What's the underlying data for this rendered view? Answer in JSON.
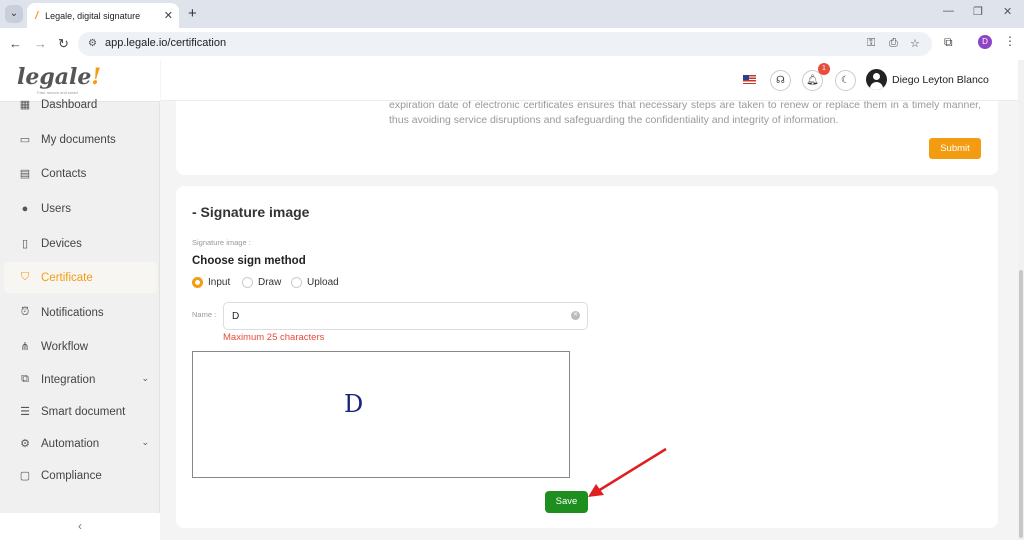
{
  "browser": {
    "tab_title": "Legale, digital signature",
    "url": "app.legale.io/certification",
    "profile_initial": "D"
  },
  "sidebar": {
    "logo": "legale",
    "logo_mark": "!",
    "tagline": "Fast, secure and smart",
    "items": [
      {
        "label": "Dashboard",
        "icon": "dashboard-icon"
      },
      {
        "label": "My documents",
        "icon": "folder-icon"
      },
      {
        "label": "Contacts",
        "icon": "contacts-icon"
      },
      {
        "label": "Users",
        "icon": "user-icon"
      },
      {
        "label": "Devices",
        "icon": "device-icon"
      },
      {
        "label": "Certificate",
        "icon": "shield-check-icon",
        "active": true
      },
      {
        "label": "Notifications",
        "icon": "alarm-icon"
      },
      {
        "label": "Workflow",
        "icon": "workflow-icon"
      },
      {
        "label": "Integration",
        "icon": "external-link-icon",
        "has_submenu": true
      },
      {
        "label": "Smart document",
        "icon": "document-icon"
      },
      {
        "label": "Automation",
        "icon": "gear-icon",
        "has_submenu": true
      },
      {
        "label": "Compliance",
        "icon": "chat-icon"
      }
    ],
    "collapse_icon": "chevron-left-icon"
  },
  "header": {
    "notification_count": "1",
    "user_name": "Diego Leyton Blanco"
  },
  "certificate_card": {
    "description": "expiration date of electronic certificates ensures that necessary steps are taken to renew or replace them in a timely manner, thus avoiding service disruptions and safeguarding the confidentiality and integrity of information.",
    "submit_label": "Submit"
  },
  "signature_card": {
    "title": "- Signature image",
    "field_label": "Signature image :",
    "method_title": "Choose sign method",
    "methods": [
      "Input",
      "Draw",
      "Upload"
    ],
    "selected_method": "Input",
    "name_label": "Name :",
    "name_value": "D",
    "error": "Maximum 25 characters",
    "preview_text": "D",
    "save_label": "Save"
  },
  "colors": {
    "accent": "#f39c12",
    "save": "#1e8f1e",
    "error": "#e74c3c",
    "annotation_arrow": "#e02020"
  }
}
